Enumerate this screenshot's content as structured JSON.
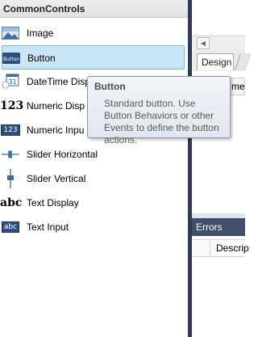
{
  "toolbox": {
    "title": "CommonControls",
    "items": [
      {
        "label": "Image",
        "icon": "image-icon"
      },
      {
        "label": "Button",
        "icon": "button-icon",
        "icon_text": "Button",
        "selected": true
      },
      {
        "label": "DateTime Disp",
        "icon": "datetime-icon",
        "icon_text": "31"
      },
      {
        "label": "Numeric Disp",
        "icon": "numeric-display-icon",
        "icon_text": "123"
      },
      {
        "label": "Numeric Inpu",
        "icon": "numeric-input-icon",
        "icon_text": "123"
      },
      {
        "label": "Slider Horizontal",
        "icon": "slider-horizontal-icon"
      },
      {
        "label": "Slider Vertical",
        "icon": "slider-vertical-icon"
      },
      {
        "label": "Text Display",
        "icon": "text-display-icon",
        "icon_text": "abc"
      },
      {
        "label": "Text Input",
        "icon": "text-input-icon",
        "icon_text": "abc"
      }
    ]
  },
  "tooltip": {
    "title": "Button",
    "body": "Standard button. Use Button Behaviors or other Events to define the button actions."
  },
  "designer": {
    "tab_design": "Design",
    "grid_header": "me"
  },
  "errors": {
    "title": "Errors",
    "column_description": "Descrip"
  },
  "colors": {
    "splitter": "#2f3c59",
    "errors_title_bg": "#424f6c",
    "selected_bg": "#c9e6f7",
    "selected_border": "#7ab9dd"
  }
}
